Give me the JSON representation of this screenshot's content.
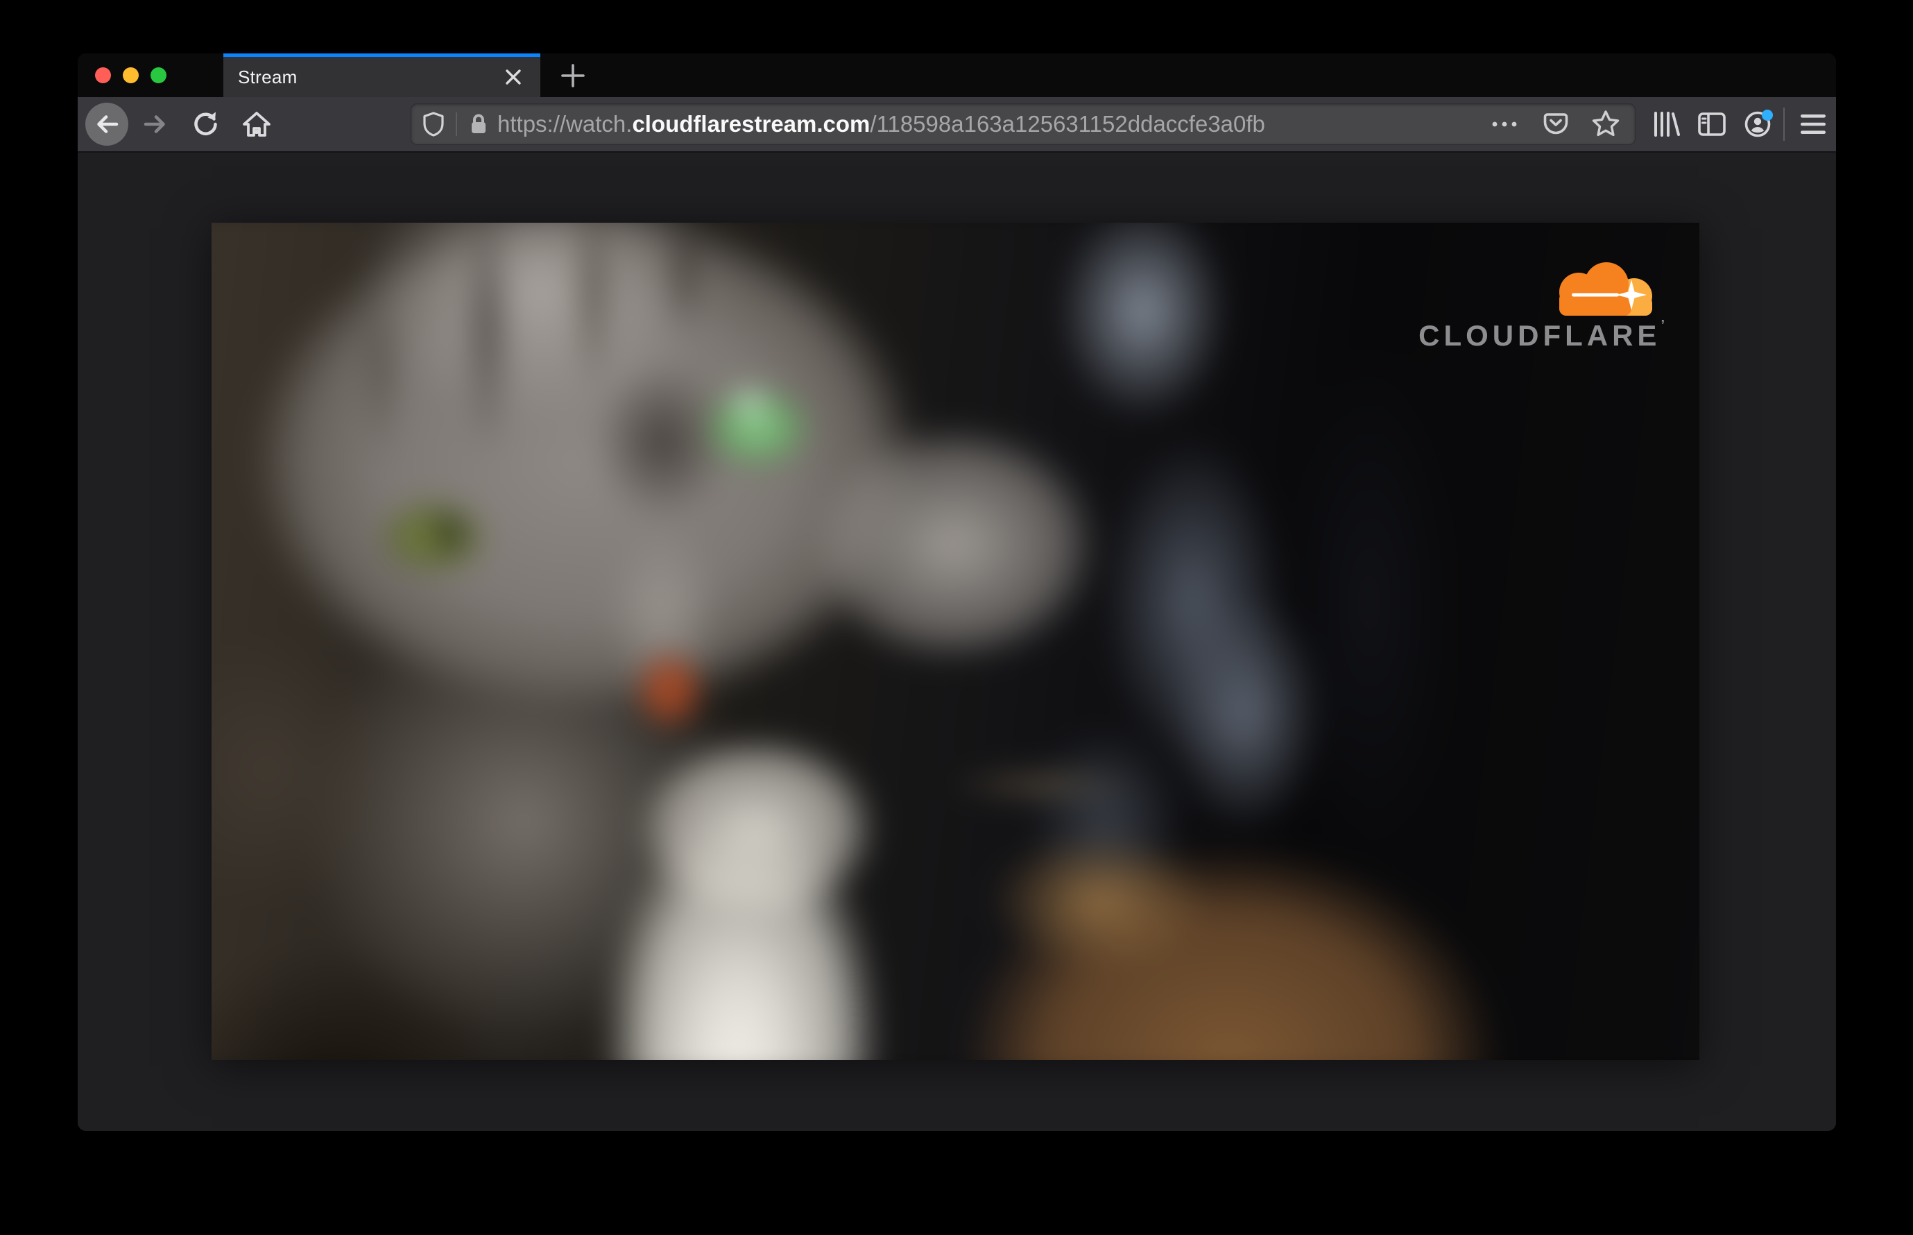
{
  "browser_window": {
    "tab_bar": {
      "tab": {
        "title": "Stream"
      },
      "window_controls": [
        "close",
        "minimize",
        "zoom"
      ]
    },
    "toolbar": {
      "url": {
        "scheme": "https://watch.",
        "domain": "cloudflarestream.com",
        "path": "/118598a163a125631152ddaccfe3a0fb"
      }
    }
  },
  "page": {
    "video_watermark": {
      "brand": "CLOUDFLARE",
      "tm": "’"
    }
  },
  "colors": {
    "tab_accent": "#0a84ff",
    "tab_bar_bg": "#0a0a0b",
    "toolbar_bg": "#39393d",
    "urlbar_bg": "#47474a",
    "page_bg": "#1f1f22",
    "notification_dot": "#2fb0ff",
    "traffic_close": "#ff5f57",
    "traffic_minimize": "#febc2e",
    "traffic_zoom": "#28c840",
    "cloudflare_orange": "#f6821f",
    "cloudflare_orange_light": "#fbad41",
    "wordmark_gray": "#8d8d90"
  },
  "icons": [
    "back-icon",
    "forward-icon",
    "reload-icon",
    "home-icon",
    "tracking-shield-icon",
    "lock-icon",
    "page-actions-icon",
    "pocket-icon",
    "bookmark-star-icon",
    "library-icon",
    "sidebar-icon",
    "account-icon",
    "menu-icon",
    "close-tab-icon",
    "new-tab-icon",
    "cloudflare-logo-icon"
  ]
}
